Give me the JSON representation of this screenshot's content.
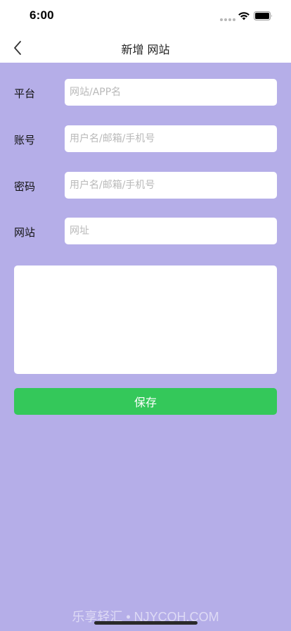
{
  "status_bar": {
    "time": "6:00"
  },
  "nav": {
    "title": "新增 网站",
    "back_icon": "chevron-left-icon"
  },
  "form": {
    "platform": {
      "label": "平台",
      "value": "",
      "placeholder": "网站/APP名"
    },
    "account": {
      "label": "账号",
      "value": "",
      "placeholder": "用户名/邮箱/手机号"
    },
    "password": {
      "label": "密码",
      "value": "",
      "placeholder": "用户名/邮箱/手机号"
    },
    "website": {
      "label": "网站",
      "value": "",
      "placeholder": "网址"
    },
    "notes": {
      "value": ""
    }
  },
  "actions": {
    "save_label": "保存"
  },
  "watermark": "乐享轻汇 • NJYCQH.COM",
  "colors": {
    "background": "#b5aee8",
    "save_button": "#34c85a",
    "bar": "#ffffff"
  }
}
